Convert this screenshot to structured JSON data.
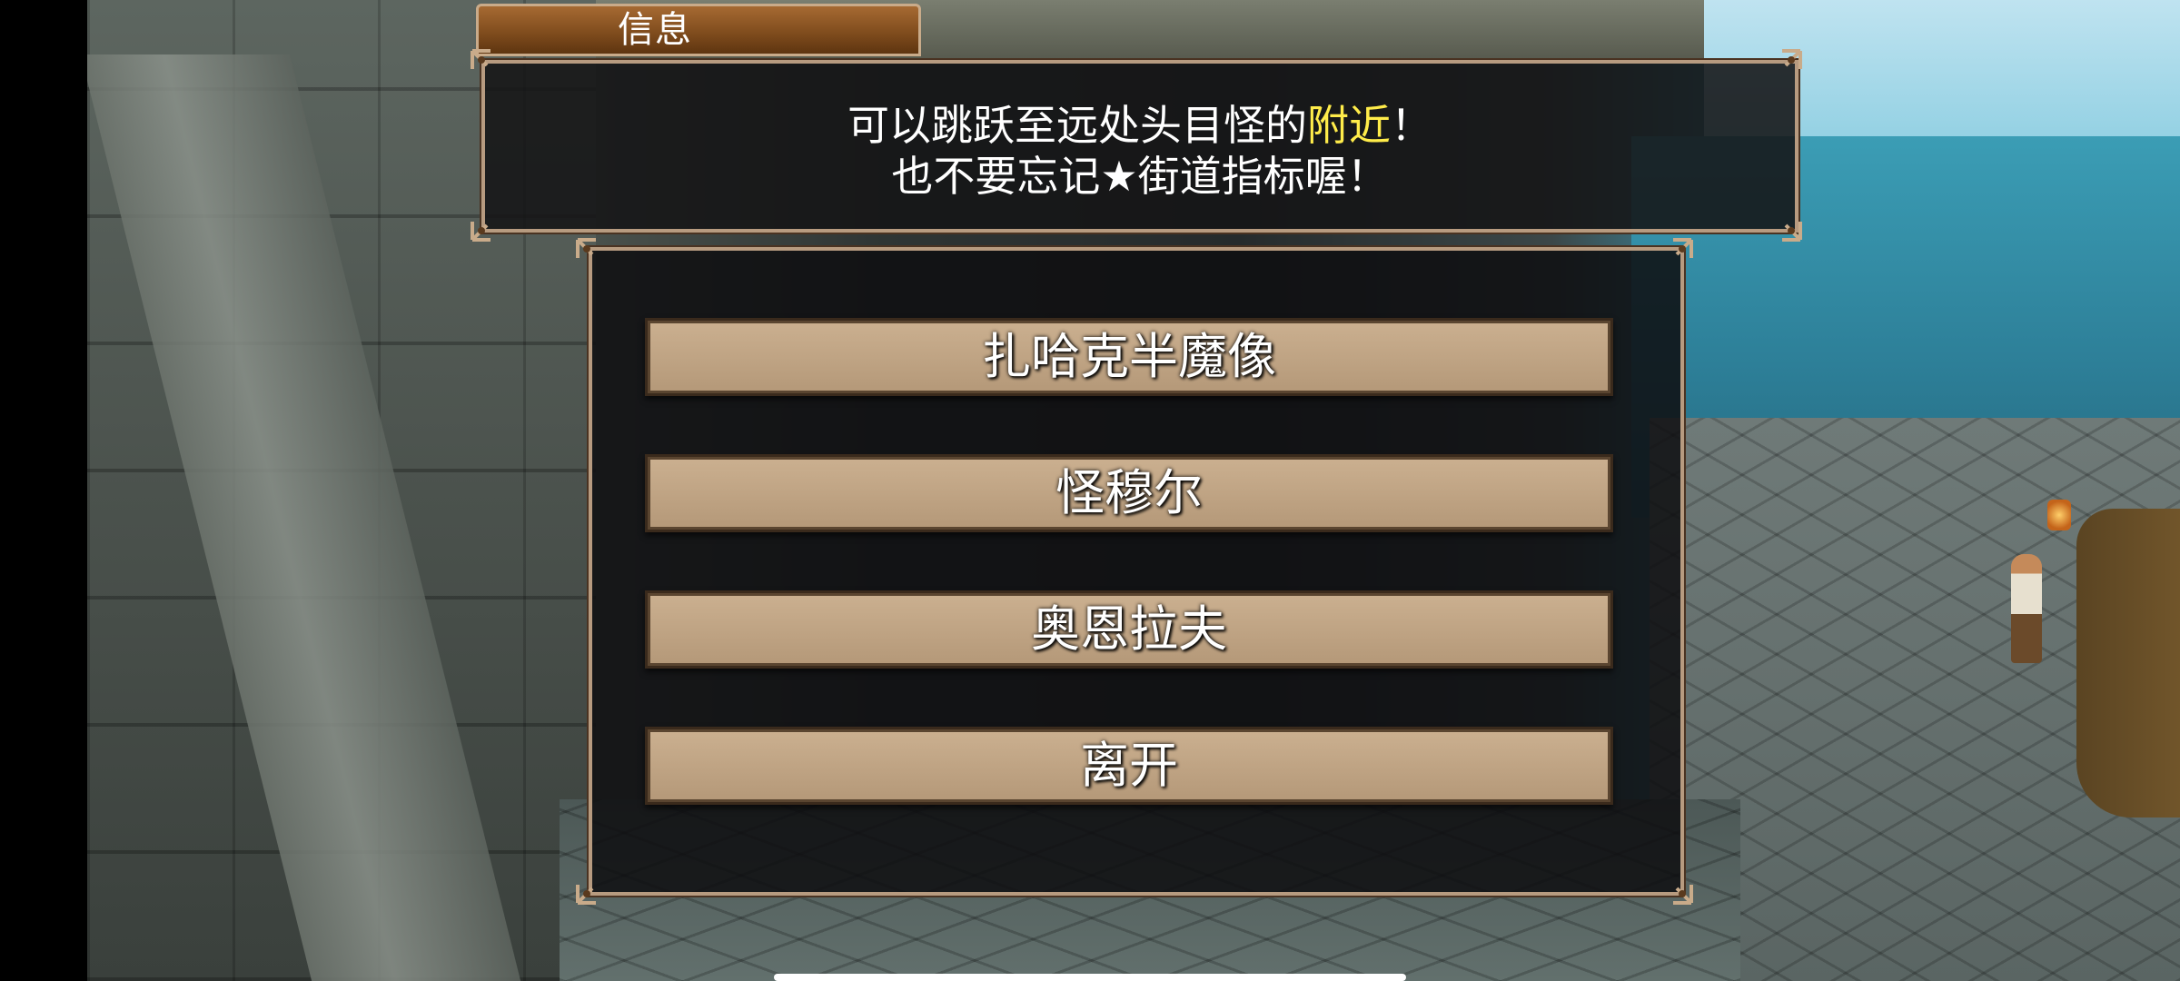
{
  "dialog": {
    "title": "信息",
    "message_line1_prefix": "可以跳跃至远处头目怪的",
    "message_line1_highlight": "附近",
    "message_line1_suffix": "！",
    "message_line2": "也不要忘记★街道指标喔！"
  },
  "choices": [
    {
      "label": "扎哈克半魔像"
    },
    {
      "label": "怪穆尔"
    },
    {
      "label": "奥恩拉夫"
    },
    {
      "label": "离开"
    }
  ],
  "colors": {
    "highlight": "#ffec4a",
    "button_fill": "#b49878",
    "panel_border": "#b79b80",
    "title_tab": "#7d4a1c"
  }
}
